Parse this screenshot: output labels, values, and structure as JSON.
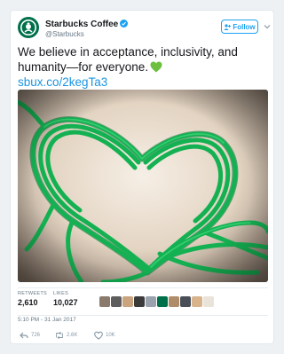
{
  "account": {
    "display_name": "Starbucks Coffee",
    "handle": "@Starbucks",
    "brand_color": "#00704a",
    "verified_color": "#1da1f2"
  },
  "follow_button": {
    "label": "Follow"
  },
  "tweet": {
    "text": "We believe in acceptance, inclusivity, and humanity—for everyone.",
    "emoji": "green-heart",
    "link": "sbux.co/2kegTa3",
    "link_color": "#1b95e0",
    "image": "green ribbon arranged in a heart shape"
  },
  "stats": {
    "retweets_label": "RETWEETS",
    "retweets_value": "2,610",
    "likes_label": "LIKES",
    "likes_value": "10,027"
  },
  "timestamp": "5:10 PM - 31 Jan 2017",
  "actions": {
    "reply_count": "726",
    "retweet_count": "2.6K",
    "like_count": "10K"
  }
}
